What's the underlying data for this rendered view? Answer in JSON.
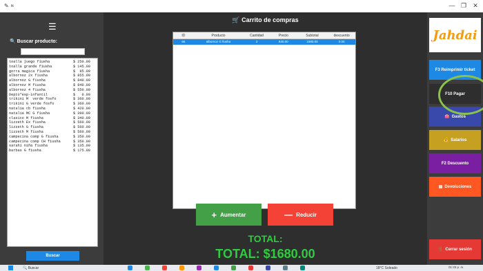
{
  "window": {
    "title": "tk",
    "minimize": "—",
    "maximize": "❐",
    "close": "✕"
  },
  "sidebar_left": {
    "menu_icon": "☰",
    "search_label": "Buscar producto:",
    "search_value": "",
    "search_button": "Buscar",
    "products": [
      {
        "name": "toalla juego fiusha",
        "price": "$ 250.00"
      },
      {
        "name": "toalla grande fiusha",
        "price": "$ 145.00"
      },
      {
        "name": "gorra magica fiusha",
        "price": "$  95.00"
      },
      {
        "name": "albornoz 2x fiusha",
        "price": "$ 855.00"
      },
      {
        "name": "albornoz G fiusha",
        "price": "$ 840.00"
      },
      {
        "name": "albornoz M fiusha",
        "price": "$ 840.00"
      },
      {
        "name": "albornoz 4 fiusha",
        "price": "$ 550.00"
      },
      {
        "name": "Depto*esp-infantil",
        "price": "$   0.00"
      },
      {
        "name": "trikini M  verde fosfo",
        "price": "$ 360.00"
      },
      {
        "name": "trikini G verde fosfo",
        "price": "$ 360.00"
      },
      {
        "name": "natalia cb fiusha",
        "price": "$ 420.00"
      },
      {
        "name": "natalia MC G fiusha",
        "price": "$ 390.00"
      },
      {
        "name": "clasico M fiusha",
        "price": "$ 340.00"
      },
      {
        "name": "lizzeth Ex fiusha",
        "price": "$ 560.00"
      },
      {
        "name": "lizzeth G fiusha",
        "price": "$ 560.00"
      },
      {
        "name": "lizzeth M fiusha",
        "price": "$ 560.00"
      },
      {
        "name": "campecina comp G fiusha",
        "price": "$ 350.00"
      },
      {
        "name": "campecina comp CH fiusha",
        "price": "$ 350.00"
      },
      {
        "name": "sarahi niña fiusha",
        "price": "$ 135.00"
      },
      {
        "name": "barbas G fiusha",
        "price": "$ 175.00"
      }
    ]
  },
  "main": {
    "title": "Carrito de compras",
    "table": {
      "headers": [
        "ID",
        "Producto",
        "Cantidad",
        "Precio",
        "Subtotal",
        "descuento"
      ],
      "rows": [
        [
          "66",
          "albornoz G fiusha",
          "2",
          "840.00",
          "1680.00",
          "0.00"
        ]
      ]
    },
    "increase_button": "Aumentar",
    "decrease_button": "Reducir",
    "total_label": "TOTAL:",
    "total_value": "TOTAL: $1680.00"
  },
  "sidebar_right": {
    "logo_text": "Jahdai",
    "reprint_button": "F3 Reimprimir ticket",
    "pay_button": "F10 Pagar",
    "expenses_button": "Gastos",
    "salaries_button": "Salarios",
    "discount_button": "F2 Descuento",
    "returns_button": "Devoluciones",
    "logout_button": "Cerrar sesión"
  },
  "taskbar": {
    "search_placeholder": "Buscar",
    "weather": "18°C Soleado",
    "time": "01:33 p. m."
  },
  "colors": {
    "sidebar_bg": "#3c3c3c",
    "main_bg": "#2e2e2e",
    "accent_blue": "#1e88e5",
    "increase_green": "#43a047",
    "decrease_red": "#f44336",
    "total_green": "#2ecc40",
    "highlight_ring": "#8bc34a"
  }
}
